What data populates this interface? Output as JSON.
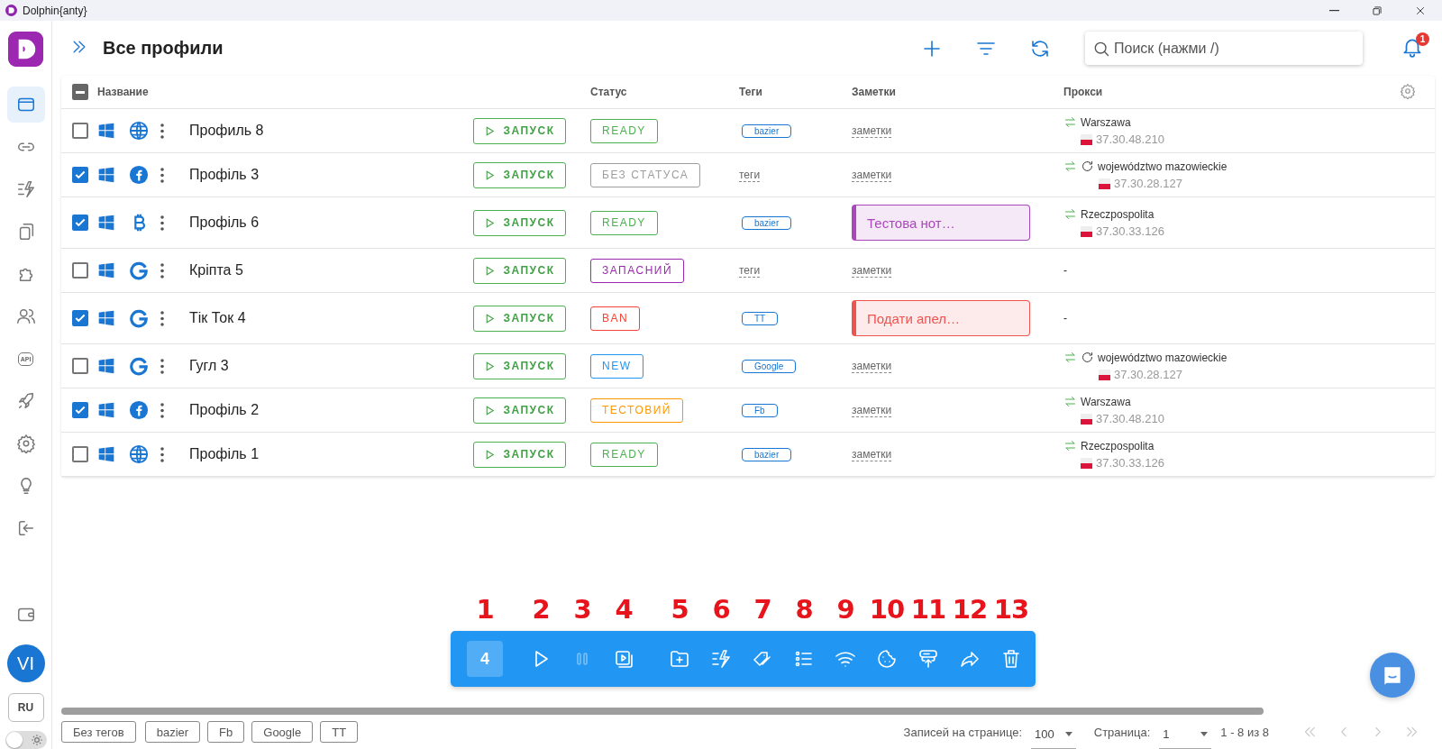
{
  "window": {
    "title": "Dolphin{anty}"
  },
  "sidebar": {
    "items": [
      {
        "kind": "browser",
        "selected": true
      },
      {
        "kind": "link",
        "selected": false
      },
      {
        "kind": "automation",
        "selected": false
      },
      {
        "kind": "copy",
        "selected": false
      },
      {
        "kind": "puzzle",
        "selected": false
      },
      {
        "kind": "users",
        "selected": false
      },
      {
        "kind": "api",
        "label": "API",
        "selected": false
      },
      {
        "kind": "rocket",
        "selected": false
      },
      {
        "kind": "settings",
        "selected": false
      },
      {
        "kind": "bulb",
        "selected": false
      },
      {
        "kind": "logout",
        "selected": false
      }
    ],
    "avatar": "VI",
    "language": "RU",
    "theme_toggle": {
      "on": false
    }
  },
  "header": {
    "title": "Все профили",
    "search": {
      "placeholder": "Поиск (нажми /)"
    },
    "notification_count": "1"
  },
  "table": {
    "columns": [
      "Название",
      "Статус",
      "Теги",
      "Заметки",
      "Прокси"
    ],
    "header_checkbox": {
      "indeterminate": true
    },
    "rows": [
      {
        "checked": false,
        "browser": {
          "kind": "globe"
        },
        "name": "Профиль 8",
        "launch": "ЗАПУСК",
        "status": {
          "label": "READY",
          "color": "#4caf50"
        },
        "tags": {
          "kind": "tag",
          "label": "bazier"
        },
        "notes": {
          "kind": "placeholder",
          "label": "заметки"
        },
        "proxy": {
          "kind": "proxy",
          "name": "Warszawa",
          "ip": "37.30.48.210",
          "rotating": false
        }
      },
      {
        "checked": true,
        "browser": {
          "kind": "facebook"
        },
        "name": "Профіль 3",
        "launch": "ЗАПУСК",
        "status": {
          "label": "БЕЗ СТАТУСА",
          "color": "#9e9e9e"
        },
        "tags": {
          "kind": "placeholder",
          "label": "теги"
        },
        "notes": {
          "kind": "placeholder",
          "label": "заметки"
        },
        "proxy": {
          "kind": "proxy",
          "name": "województwo mazowieckie",
          "ip": "37.30.28.127",
          "rotating": true
        }
      },
      {
        "checked": true,
        "browser": {
          "kind": "bitcoin"
        },
        "name": "Профіль 6",
        "launch": "ЗАПУСК",
        "status": {
          "label": "READY",
          "color": "#4caf50"
        },
        "tags": {
          "kind": "tag",
          "label": "bazier"
        },
        "notes": {
          "kind": "note",
          "label": "Тестова нот…",
          "color": "#ab47bc"
        },
        "proxy": {
          "kind": "proxy",
          "name": "Rzeczpospolita",
          "ip": "37.30.33.126",
          "rotating": false
        }
      },
      {
        "checked": false,
        "browser": {
          "kind": "google"
        },
        "name": "Кріпта 5",
        "launch": "ЗАПУСК",
        "status": {
          "label": "ЗАПАСНИЙ",
          "color": "#9c27b0"
        },
        "tags": {
          "kind": "placeholder",
          "label": "теги"
        },
        "notes": {
          "kind": "placeholder",
          "label": "заметки"
        },
        "proxy": {
          "kind": "none",
          "label": "-"
        }
      },
      {
        "checked": true,
        "browser": {
          "kind": "google"
        },
        "name": "Тік Ток 4",
        "launch": "ЗАПУСК",
        "status": {
          "label": "BAN",
          "color": "#f44336"
        },
        "tags": {
          "kind": "tag",
          "label": "TT"
        },
        "notes": {
          "kind": "note",
          "label": "Подати апел…",
          "color": "#ef5350"
        },
        "proxy": {
          "kind": "none",
          "label": "-"
        }
      },
      {
        "checked": false,
        "browser": {
          "kind": "google"
        },
        "name": "Гугл 3",
        "launch": "ЗАПУСК",
        "status": {
          "label": "NEW",
          "color": "#2196f3"
        },
        "tags": {
          "kind": "tag",
          "label": "Google"
        },
        "notes": {
          "kind": "placeholder",
          "label": "заметки"
        },
        "proxy": {
          "kind": "proxy",
          "name": "województwo mazowieckie",
          "ip": "37.30.28.127",
          "rotating": true
        }
      },
      {
        "checked": true,
        "browser": {
          "kind": "facebook"
        },
        "name": "Профіль 2",
        "launch": "ЗАПУСК",
        "status": {
          "label": "ТЕСТОВИЙ",
          "color": "#ff9800"
        },
        "tags": {
          "kind": "tag",
          "label": "Fb"
        },
        "notes": {
          "kind": "placeholder",
          "label": "заметки"
        },
        "proxy": {
          "kind": "proxy",
          "name": "Warszawa",
          "ip": "37.30.48.210",
          "rotating": false
        }
      },
      {
        "checked": false,
        "browser": {
          "kind": "globe"
        },
        "name": "Профіль 1",
        "launch": "ЗАПУСК",
        "status": {
          "label": "READY",
          "color": "#4caf50"
        },
        "tags": {
          "kind": "tag",
          "label": "bazier"
        },
        "notes": {
          "kind": "placeholder",
          "label": "заметки"
        },
        "proxy": {
          "kind": "proxy",
          "name": "Rzeczpospolita",
          "ip": "37.30.33.126",
          "rotating": false
        }
      }
    ]
  },
  "bulk_toolbar": {
    "items": [
      {
        "kind": "count",
        "label": "4",
        "annotation": "1",
        "disabled": false
      },
      {
        "kind": "play",
        "annotation": "2",
        "disabled": false
      },
      {
        "kind": "pause",
        "annotation": "3",
        "disabled": true
      },
      {
        "kind": "video",
        "annotation": "4",
        "disabled": false
      },
      {
        "kind": "folder",
        "annotation": "5",
        "disabled": false
      },
      {
        "kind": "automation",
        "annotation": "6",
        "disabled": false
      },
      {
        "kind": "tag",
        "annotation": "7",
        "disabled": false
      },
      {
        "kind": "list",
        "annotation": "8",
        "disabled": false
      },
      {
        "kind": "wifi",
        "annotation": "9",
        "disabled": false
      },
      {
        "kind": "cookie",
        "annotation": "10",
        "disabled": false
      },
      {
        "kind": "server",
        "annotation": "11",
        "disabled": false
      },
      {
        "kind": "share",
        "annotation": "12",
        "disabled": false
      },
      {
        "kind": "trash",
        "annotation": "13",
        "disabled": false
      }
    ]
  },
  "footer": {
    "tag_filters": [
      "Без тегов",
      "bazier",
      "Fb",
      "Google",
      "TT"
    ],
    "per_page_label": "Записей на странице:",
    "per_page": "100",
    "page_label": "Страница:",
    "page": "1",
    "range": "1 - 8 из 8"
  }
}
